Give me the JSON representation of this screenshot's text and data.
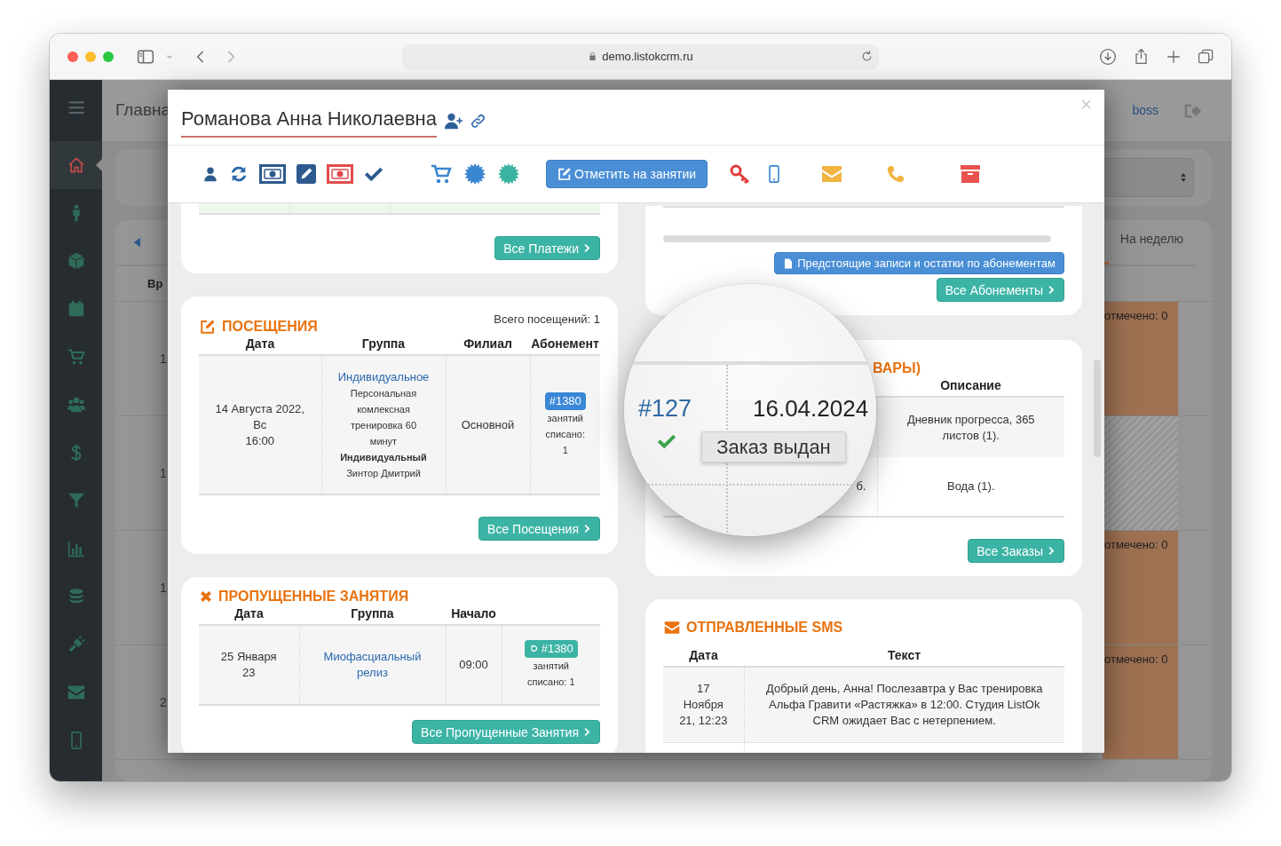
{
  "browser": {
    "url": "demo.listokcrm.ru"
  },
  "app": {
    "page_title": "Главна",
    "user": "boss",
    "sidebar": [
      {
        "selected": true
      },
      {
        "selected": false
      },
      {
        "selected": false
      },
      {
        "selected": false
      },
      {
        "selected": false
      },
      {
        "selected": false
      },
      {
        "selected": false
      },
      {
        "selected": false
      },
      {
        "selected": false
      },
      {
        "selected": false
      },
      {
        "selected": false
      },
      {
        "selected": false
      },
      {
        "selected": false
      }
    ],
    "calendar": {
      "tab": "На неделю",
      "column_head": "Вр",
      "rows": [
        {
          "label": "1",
          "kind": "slot",
          "status": "отмечено: 0"
        },
        {
          "label": "1",
          "kind": "hatched"
        },
        {
          "label": "1",
          "kind": "slot",
          "status": "отмечено: 0"
        },
        {
          "label": "2",
          "kind": "slot",
          "status": "отмечено: 0"
        }
      ]
    }
  },
  "modal": {
    "title": "Романова Анна Николаевна",
    "close": "×",
    "mark_button": "Отметить на занятии",
    "payments": {
      "button": "Все Платежи"
    },
    "visits": {
      "title": "ПОСЕЩЕНИЯ",
      "total": "Всего посещений: 1",
      "columns": [
        "Дата",
        "Группа",
        "Филиал",
        "Абонемент"
      ],
      "rows": [
        {
          "date_lines": [
            "14 Августа 2022,",
            "Вс",
            "16:00"
          ],
          "group": "Индивидуальное",
          "description": "Персональная комлексная тренировка 60 минут",
          "group_type": "Индивидуальный",
          "trainer": "Зинтор Дмитрий",
          "branch": "Основной",
          "subscription": "#1380",
          "written_off": "занятий списано: 1"
        }
      ],
      "button": "Все Посещения"
    },
    "missed": {
      "title": "ПРОПУЩЕННЫЕ ЗАНЯТИЯ",
      "columns": [
        "Дата",
        "Группа",
        "Начало"
      ],
      "rows": [
        {
          "date_lines": [
            "25 Января",
            "23"
          ],
          "group": "Миофасциальный релиз",
          "start": "09:00",
          "subscription": "#1380",
          "written_off": "занятий списано: 1"
        }
      ],
      "button": "Все Пропущенные Занятия"
    },
    "subscriptions": {
      "upcoming_button": "Предстоящие записи и остатки по абонементам",
      "button": "Все Абонементы"
    },
    "orders": {
      "title": "ВАРЫ)",
      "columns": [
        "Описание"
      ],
      "rows": [
        {
          "description": "Дневник прогресса, 365 листов (1)."
        },
        {
          "cell": "б.",
          "description": "Вода (1)."
        }
      ],
      "button": "Все Заказы"
    },
    "sms": {
      "title": "ОТПРАВЛЕННЫЕ SMS",
      "columns": [
        "Дата",
        "Текст"
      ],
      "rows": [
        {
          "date_lines": [
            "17",
            "Ноября",
            "21, 12:23"
          ],
          "text": "Добрый день, Анна! Послезавтра у Вас тренировка Альфа Гравити «Растяжка» в 12:00. Студия ListOk CRM ожидает Вас с нетерпением."
        }
      ]
    },
    "magnifier": {
      "order_number": "#127",
      "issued": true,
      "date": "16.04.2024",
      "tooltip": "Заказ выдан"
    }
  }
}
